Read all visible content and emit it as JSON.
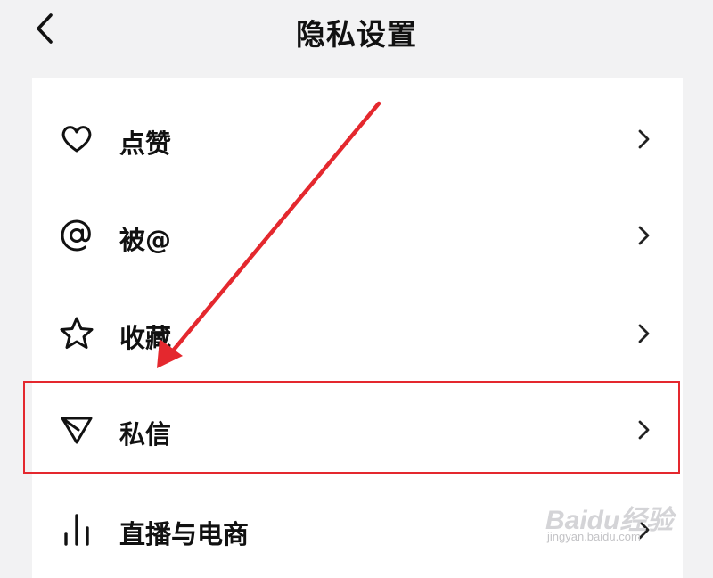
{
  "header": {
    "title": "隐私设置",
    "back_icon": "chevron-left-icon"
  },
  "settings": [
    {
      "label": "点赞",
      "icon": "heart-icon"
    },
    {
      "label": "被@",
      "icon": "at-sign-icon"
    },
    {
      "label": "收藏",
      "icon": "star-icon"
    },
    {
      "label": "私信",
      "icon": "send-icon",
      "highlighted": true
    },
    {
      "label": "直播与电商",
      "icon": "bar-chart-icon"
    }
  ],
  "annotation": {
    "arrow_color": "#e4282e",
    "box_color": "#e4282e"
  },
  "watermark": {
    "brand": "Baidu经验",
    "url": "jingyan.baidu.com"
  }
}
